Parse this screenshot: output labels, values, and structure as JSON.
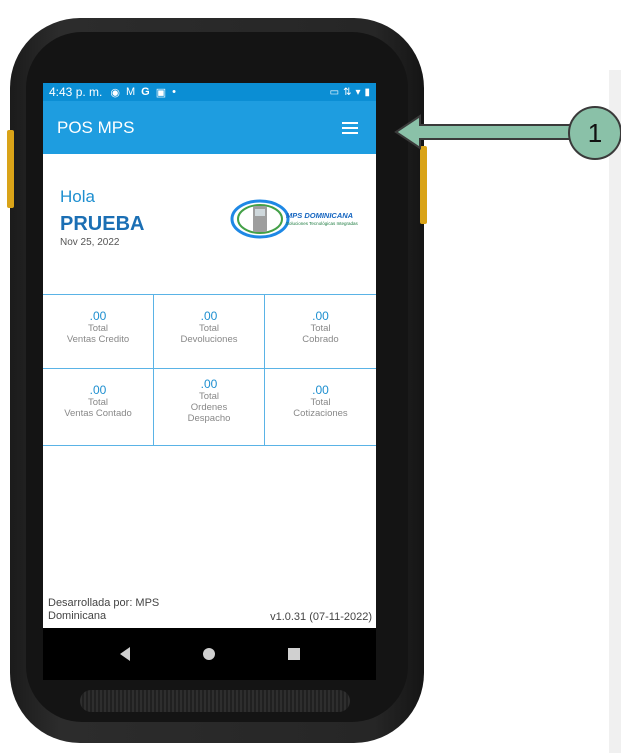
{
  "status_bar": {
    "time": "4:43 p. m.",
    "icons": [
      "chrome-icon",
      "gmail-icon",
      "google-icon",
      "image-icon",
      "dot-icon"
    ],
    "right_icons": [
      "cast-icon",
      "data-icon",
      "wifi-icon",
      "battery-icon"
    ]
  },
  "app_bar": {
    "title": "POS MPS",
    "menu_icon": "hamburger-menu-icon"
  },
  "home": {
    "greeting": "Hola",
    "user_name": "PRUEBA",
    "date": "Nov 25, 2022",
    "logo_text": "MPS DOMINICANA",
    "logo_subtext": "Soluciones Tecnológicas Integradas"
  },
  "stats": [
    {
      "value": ".00",
      "label": "Total\nVentas Credito"
    },
    {
      "value": ".00",
      "label": "Total\nDevoluciones"
    },
    {
      "value": ".00",
      "label": "Total\nCobrado"
    },
    {
      "value": ".00",
      "label": "Total\nVentas Contado"
    },
    {
      "value": ".00",
      "label": "Total\nOrdenes\nDespacho"
    },
    {
      "value": ".00",
      "label": "Total\nCotizaciones"
    }
  ],
  "footer": {
    "developer": "Desarrollada por: MPS Dominicana",
    "version": "v1.0.31 (07-11-2022)"
  },
  "callout": {
    "number": "1"
  },
  "colors": {
    "app_bar": "#1e9de0",
    "status_bar": "#0b8ed4",
    "accent_text": "#1e8fd0",
    "grid_lines": "#5ab3e6",
    "callout_badge": "#8ac1a8",
    "device_button": "#d9a318"
  }
}
